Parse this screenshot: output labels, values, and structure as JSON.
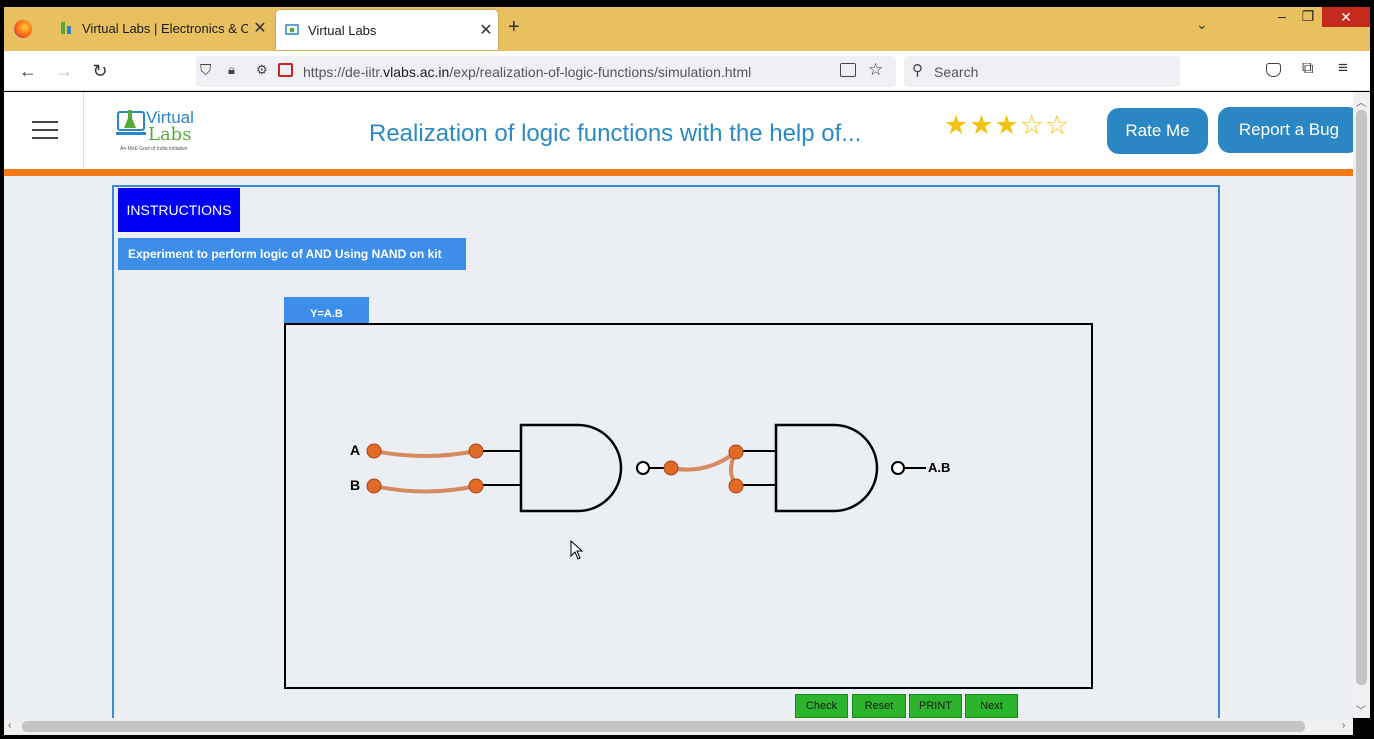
{
  "browser": {
    "tabs": [
      {
        "title": "Virtual Labs | Electronics & Com",
        "active": false
      },
      {
        "title": "Virtual Labs",
        "active": true
      }
    ],
    "url_prefix": "https://de-iitr.",
    "url_domain": "vlabs.ac.in",
    "url_path": "/exp/realization-of-logic-functions/simulation.html",
    "search_placeholder": "Search"
  },
  "header": {
    "logo_line1": "Virtual",
    "logo_line2": "Labs",
    "logo_subtitle": "An MoE Govt of India Initiative",
    "title": "Realization of logic functions with the help of...",
    "rating_filled": 3,
    "rating_max": 5,
    "rate_me_label": "Rate Me",
    "report_bug_label": "Report a Bug"
  },
  "main": {
    "instructions_label": "INSTRUCTIONS",
    "experiment_label": "Experiment to perform logic of AND Using NAND on kit",
    "circuit_tab_label": "Y=A.B",
    "circuit": {
      "input_a_label": "A",
      "input_b_label": "B",
      "output_label": "A.B"
    },
    "buttons": {
      "check": "Check",
      "reset": "Reset",
      "print": "PRINT",
      "next": "Next"
    }
  },
  "colors": {
    "accent_blue": "#2a87c3",
    "instructions_bg": "#0000f5",
    "orange_bar": "#f57a14",
    "wire": "#d68a60",
    "terminal": "#e06a26",
    "action_button": "#2db42d"
  }
}
